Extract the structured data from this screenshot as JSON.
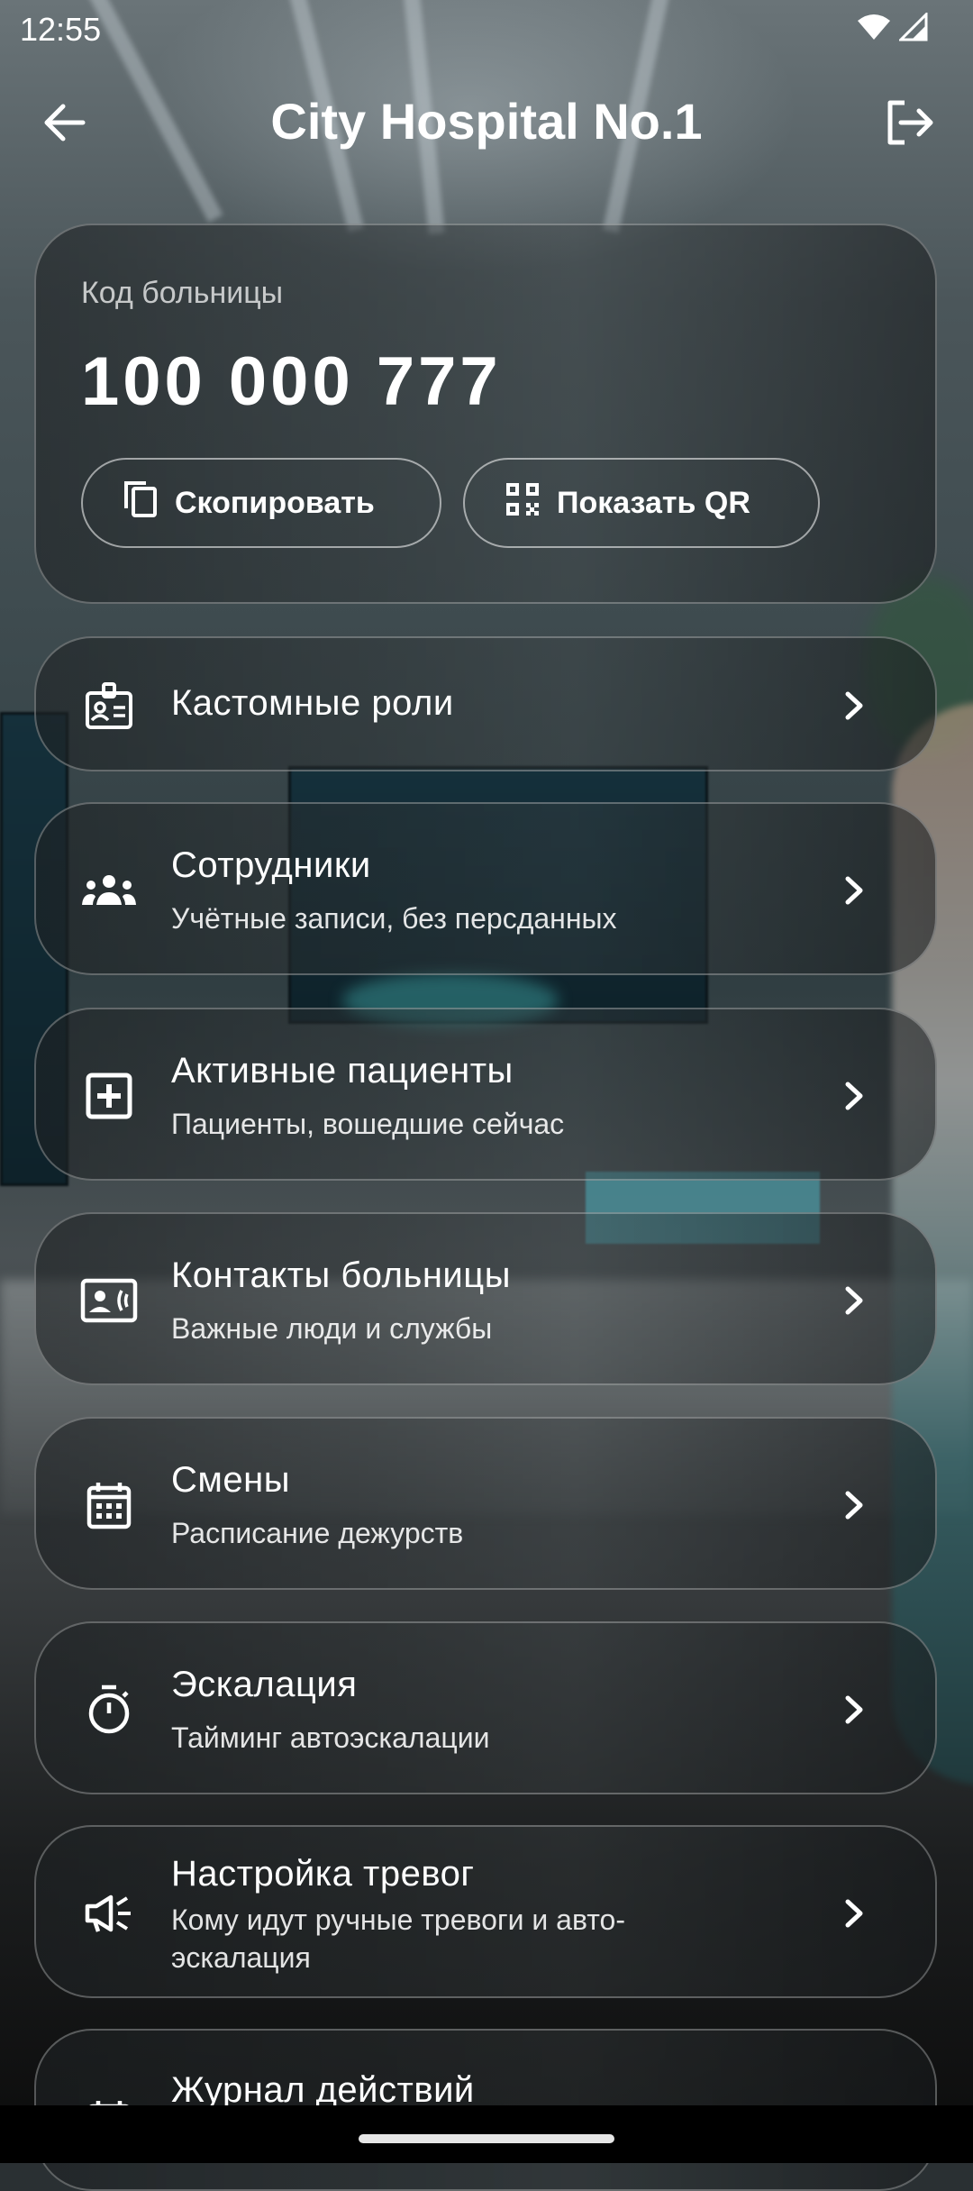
{
  "status_bar": {
    "time": "12:55"
  },
  "app_bar": {
    "title": "City Hospital No.1"
  },
  "hospital_code": {
    "label": "Код больницы",
    "value": "100 000 777",
    "copy_label": "Скопировать",
    "qr_label": "Показать QR"
  },
  "menu": [
    {
      "title": "Кастомные роли",
      "subtitle": "",
      "icon": "badge-icon"
    },
    {
      "title": "Сотрудники",
      "subtitle": "Учётные записи, без персданных",
      "icon": "group-icon"
    },
    {
      "title": "Активные пациенты",
      "subtitle": "Пациенты, вошедшие сейчас",
      "icon": "medical-plus-icon"
    },
    {
      "title": "Контакты больницы",
      "subtitle": "Важные люди и службы",
      "icon": "contact-phone-icon"
    },
    {
      "title": "Смены",
      "subtitle": "Расписание дежурств",
      "icon": "calendar-icon"
    },
    {
      "title": "Эскалация",
      "subtitle": "Тайминг автоэскалации",
      "icon": "timer-icon"
    },
    {
      "title": "Настройка тревог",
      "subtitle": "Кому идут ручные тревоги и авто-эскалация",
      "icon": "campaign-icon"
    },
    {
      "title": "Журнал действий",
      "subtitle": "",
      "icon": "history-icon"
    }
  ],
  "colors": {
    "text": "#ffffff",
    "card_border": "rgba(255,255,255,0.28)",
    "nav_bar": "#000000"
  }
}
